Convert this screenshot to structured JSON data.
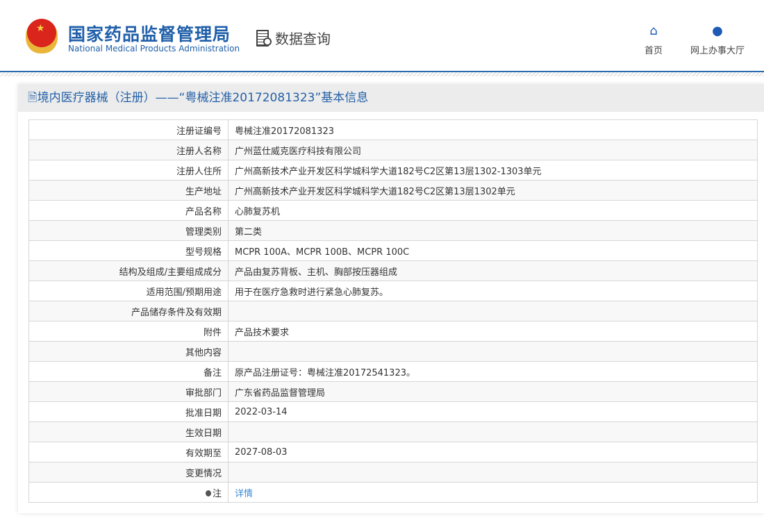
{
  "header": {
    "logo_cn": "国家药品监督管理局",
    "logo_en": "National Medical Products Administration",
    "data_query": "数据查询",
    "nav": [
      {
        "label": "首页",
        "icon": "home-icon"
      },
      {
        "label": "网上办事大厅",
        "icon": "user-icon"
      }
    ]
  },
  "panel": {
    "title": "境内医疗器械（注册）——“粤械注准20172081323”基本信息"
  },
  "rows": [
    {
      "label": "注册证编号",
      "value": "粤械注准20172081323"
    },
    {
      "label": "注册人名称",
      "value": "广州蓝仕威克医疗科技有限公司"
    },
    {
      "label": "注册人住所",
      "value": "广州高新技术产业开发区科学城科学大道182号C2区第13层1302-1303单元"
    },
    {
      "label": "生产地址",
      "value": "广州高新技术产业开发区科学城科学大道182号C2区第13层1302单元"
    },
    {
      "label": "产品名称",
      "value": "心肺复苏机"
    },
    {
      "label": "管理类别",
      "value": "第二类"
    },
    {
      "label": "型号规格",
      "value": "MCPR 100A、MCPR 100B、MCPR 100C"
    },
    {
      "label": "结构及组成/主要组成成分",
      "value": "产品由复苏背板、主机、胸部按压器组成"
    },
    {
      "label": "适用范围/预期用途",
      "value": "用于在医疗急救时进行紧急心肺复苏。"
    },
    {
      "label": "产品储存条件及有效期",
      "value": ""
    },
    {
      "label": "附件",
      "value": "产品技术要求"
    },
    {
      "label": "其他内容",
      "value": ""
    },
    {
      "label": "备注",
      "value": "原产品注册证号：粤械注准20172541323。"
    },
    {
      "label": "审批部门",
      "value": "广东省药品监督管理局"
    },
    {
      "label": "批准日期",
      "value": "2022-03-14"
    },
    {
      "label": "生效日期",
      "value": ""
    },
    {
      "label": "有效期至",
      "value": "2027-08-03"
    },
    {
      "label": "变更情况",
      "value": ""
    }
  ],
  "note": {
    "label": "注",
    "link": "详情"
  }
}
